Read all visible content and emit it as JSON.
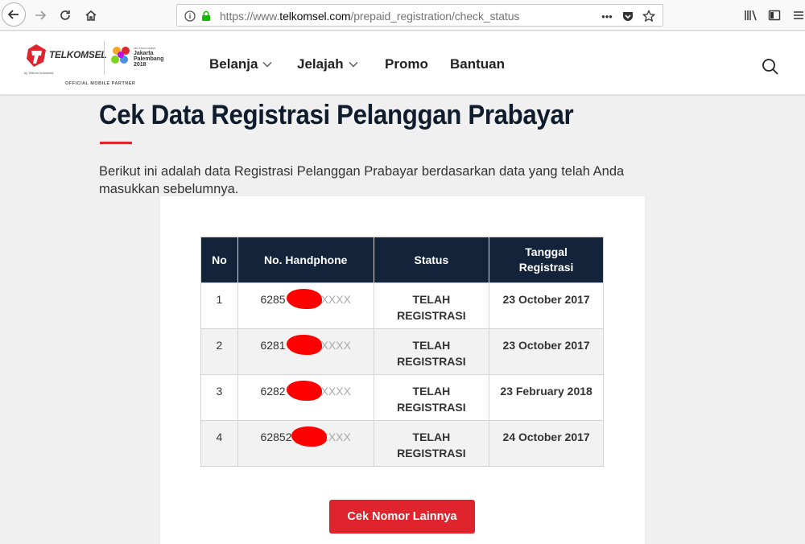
{
  "browser": {
    "url_prefix": "https://www.",
    "url_domain": "telkomsel.com",
    "url_path": "/prepaid_registration/check_status",
    "menu_dots": "•••"
  },
  "header": {
    "logo_text": "TELKOMSEL",
    "logo_tagline": "by Telkom Indonesia",
    "partner_text": "OFFICIAL MOBILE PARTNER",
    "asian_games_small": "18th ASIAN GAMES",
    "asian_games": "Jakarta Palembang 2018",
    "nav": [
      {
        "label": "Belanja",
        "has_dropdown": true
      },
      {
        "label": "Jelajah",
        "has_dropdown": true
      },
      {
        "label": "Promo",
        "has_dropdown": false
      },
      {
        "label": "Bantuan",
        "has_dropdown": false
      }
    ]
  },
  "main": {
    "title": "Cek Data Registrasi Pelanggan Prabayar",
    "intro": "Berikut ini adalah data Registrasi Pelanggan Prabayar berdasarkan data yang telah Anda masukkan sebelumnya.",
    "table": {
      "headers": [
        "No",
        "No. Handphone",
        "Status",
        "Tanggal Registrasi"
      ],
      "rows": [
        {
          "no": "1",
          "phone_prefix": "6285",
          "phone_suffix": "XXXX",
          "status": "TELAH REGISTRASI",
          "date": "23 October 2017"
        },
        {
          "no": "2",
          "phone_prefix": "6281",
          "phone_suffix": "XXXX",
          "status": "TELAH REGISTRASI",
          "date": "23 October 2017"
        },
        {
          "no": "3",
          "phone_prefix": "6282",
          "phone_suffix": "XXXX",
          "status": "TELAH REGISTRASI",
          "date": "23 February 2018"
        },
        {
          "no": "4",
          "phone_prefix": "62852",
          "phone_suffix": "XXXX",
          "status": "TELAH REGISTRASI",
          "date": "24 October 2017"
        }
      ]
    },
    "cta_label": "Cek Nomor Lainnya"
  },
  "colors": {
    "brand_red": "#e0242d",
    "table_header": "#13233a",
    "title": "#0f1c2e"
  }
}
